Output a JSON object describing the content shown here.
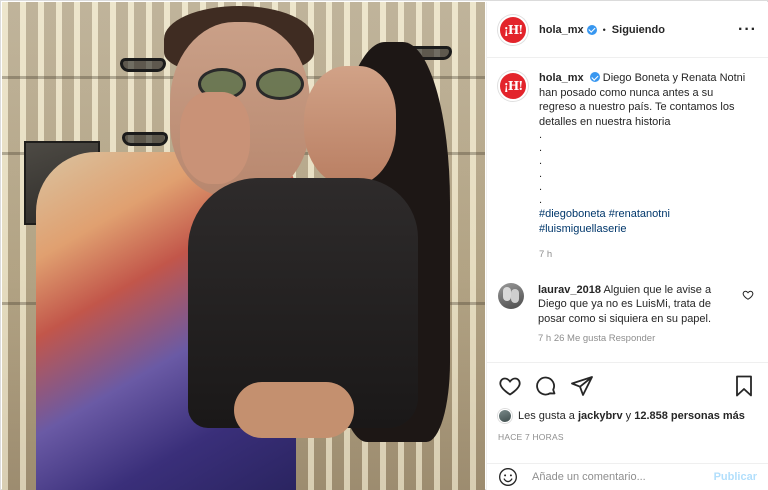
{
  "post": {
    "image_alt": "Diego Boneta y Renata Notni posando",
    "account": {
      "avatar_text": "¡H!",
      "username": "hola_mx",
      "verified": true,
      "follow_status": "Siguiendo",
      "separator": "•"
    },
    "caption": {
      "username": "hola_mx",
      "text": "Diego Boneta y Renata Notni han posado como nunca antes a su regreso a nuestro país. Te contamos los detalles en nuestra historia",
      "dots": [
        ".",
        ".",
        ".",
        ".",
        ".",
        "."
      ],
      "hashtags_line1": "#diegoboneta #renatanotni",
      "hashtags_line2": "#luismiguellaserie",
      "time": "7 h"
    },
    "comments": [
      {
        "username": "laurav_2018",
        "text": "Alguien que le avise a Diego que ya no es LuisMi, trata de posar como si siquiera en su papel.",
        "meta": "7 h   26 Me gusta   Responder"
      }
    ],
    "likes": {
      "prefix": "Les gusta a",
      "user": "jackybrv",
      "middle": "y",
      "count": "12.858 personas más"
    },
    "posted": "HACE 7 HORAS",
    "add_comment": {
      "placeholder": "Añade un comentario...",
      "publish_label": "Publicar"
    },
    "colors": {
      "brand_red": "#e3242b",
      "verified_blue": "#3897f0",
      "hashtag": "#00376b",
      "publish_disabled": "#b2dffc"
    },
    "icons": {
      "more": "more-options-icon",
      "like": "heart-icon",
      "comment": "comment-icon",
      "share": "share-icon",
      "save": "bookmark-icon",
      "emoji": "emoji-icon"
    }
  }
}
